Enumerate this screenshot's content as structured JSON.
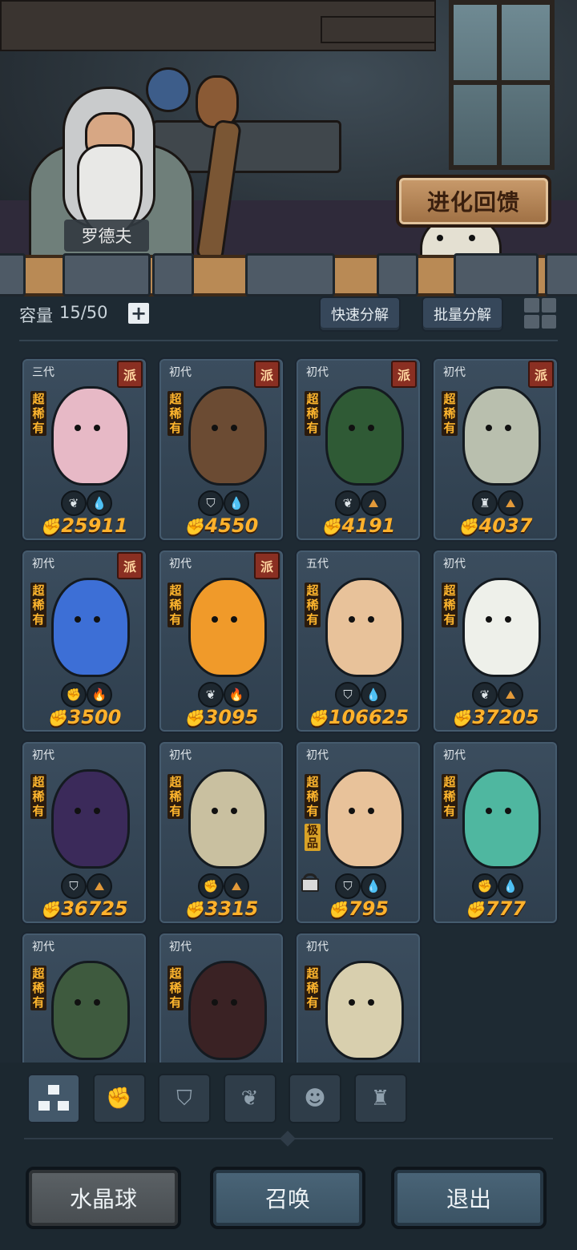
{
  "header": {
    "npc_name": "罗德夫",
    "evolution_button_label": "进化回馈"
  },
  "toolbar": {
    "capacity_label": "容量",
    "capacity_value": "15/50",
    "add_symbol": "+",
    "quick_decompose_label": "快速分解",
    "batch_decompose_label": "批量分解"
  },
  "cards": [
    {
      "generation": "三代",
      "faction_badge": "派",
      "rarity": "超稀有",
      "extra_badge": "",
      "power": "25911",
      "attributes": [
        "sprout-icon",
        "water-drop-icon"
      ],
      "locked": false,
      "color": "#e7b9c6"
    },
    {
      "generation": "初代",
      "faction_badge": "派",
      "rarity": "超稀有",
      "extra_badge": "",
      "power": "4550",
      "attributes": [
        "shield-icon",
        "water-drop-icon"
      ],
      "locked": false,
      "color": "#6b4b33"
    },
    {
      "generation": "初代",
      "faction_badge": "派",
      "rarity": "超稀有",
      "extra_badge": "",
      "power": "4191",
      "attributes": [
        "sprout-icon",
        "earth-icon"
      ],
      "locked": false,
      "color": "#2f5a35"
    },
    {
      "generation": "初代",
      "faction_badge": "派",
      "rarity": "超稀有",
      "extra_badge": "",
      "power": "4037",
      "attributes": [
        "tower-icon",
        "earth-icon"
      ],
      "locked": false,
      "color": "#b9bfae"
    },
    {
      "generation": "初代",
      "faction_badge": "派",
      "rarity": "超稀有",
      "extra_badge": "",
      "power": "3500",
      "attributes": [
        "fist-icon",
        "fire-icon"
      ],
      "locked": false,
      "color": "#3d6fd6"
    },
    {
      "generation": "初代",
      "faction_badge": "派",
      "rarity": "超稀有",
      "extra_badge": "",
      "power": "3095",
      "attributes": [
        "sprout-icon",
        "fire-icon"
      ],
      "locked": false,
      "color": "#f09a2a"
    },
    {
      "generation": "五代",
      "faction_badge": "",
      "rarity": "超稀有",
      "extra_badge": "",
      "power": "106625",
      "attributes": [
        "shield-icon",
        "water-drop-icon"
      ],
      "locked": false,
      "color": "#e8c29a"
    },
    {
      "generation": "初代",
      "faction_badge": "",
      "rarity": "超稀有",
      "extra_badge": "",
      "power": "37205",
      "attributes": [
        "sprout-icon",
        "earth-icon"
      ],
      "locked": false,
      "color": "#eef0ea"
    },
    {
      "generation": "初代",
      "faction_badge": "",
      "rarity": "超稀有",
      "extra_badge": "",
      "power": "36725",
      "attributes": [
        "shield-icon",
        "earth-icon"
      ],
      "locked": false,
      "color": "#3b2a5a"
    },
    {
      "generation": "初代",
      "faction_badge": "",
      "rarity": "超稀有",
      "extra_badge": "",
      "power": "3315",
      "attributes": [
        "fist-icon",
        "earth-icon"
      ],
      "locked": false,
      "color": "#c9c0a0"
    },
    {
      "generation": "初代",
      "faction_badge": "",
      "rarity": "超稀有",
      "extra_badge": "极品",
      "power": "795",
      "attributes": [
        "shield-icon",
        "water-drop-icon"
      ],
      "locked": true,
      "color": "#e8c29a"
    },
    {
      "generation": "初代",
      "faction_badge": "",
      "rarity": "超稀有",
      "extra_badge": "",
      "power": "777",
      "attributes": [
        "fist-icon",
        "water-drop-icon"
      ],
      "locked": false,
      "color": "#4fb7a0"
    },
    {
      "generation": "初代",
      "faction_badge": "",
      "rarity": "超稀有",
      "extra_badge": "",
      "power": "",
      "attributes": [],
      "locked": false,
      "color": "#3e5a3e"
    },
    {
      "generation": "初代",
      "faction_badge": "",
      "rarity": "超稀有",
      "extra_badge": "",
      "power": "",
      "attributes": [],
      "locked": false,
      "color": "#3a2224"
    },
    {
      "generation": "初代",
      "faction_badge": "",
      "rarity": "超稀有",
      "extra_badge": "",
      "power": "",
      "attributes": [],
      "locked": false,
      "color": "#d8cfae"
    }
  ],
  "filter_tabs": [
    {
      "icon": "all-blocks-icon",
      "active": true
    },
    {
      "icon": "fist-icon",
      "active": false
    },
    {
      "icon": "shield-icon",
      "active": false
    },
    {
      "icon": "sprout-icon",
      "active": false
    },
    {
      "icon": "alien-face-icon",
      "active": false
    },
    {
      "icon": "tower-icon",
      "active": false
    }
  ],
  "bottom_buttons": {
    "crystal_ball_label": "水晶球",
    "summon_label": "召唤",
    "exit_label": "退出"
  },
  "colors": {
    "background": "#1e2a33",
    "card": "#3b4d5e",
    "power_text": "#ffb22c",
    "faction_badge": "#8a2f22"
  }
}
